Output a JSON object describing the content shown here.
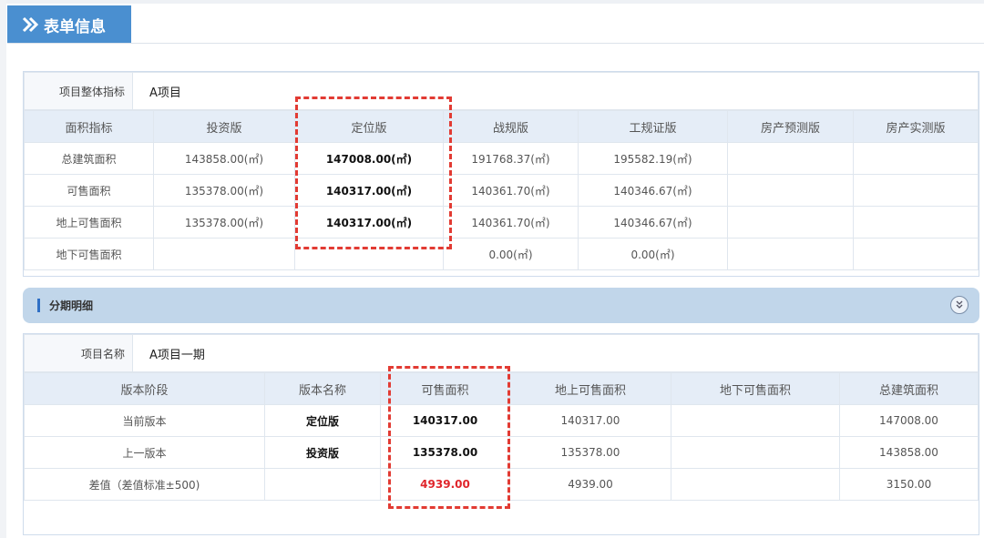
{
  "page": {
    "title": "表单信息"
  },
  "summary": {
    "project_label": "项目整体指标",
    "project_value": "A项目",
    "headers": [
      "面积指标",
      "投资版",
      "定位版",
      "战规版",
      "工规证版",
      "房产预测版",
      "房产实测版"
    ],
    "rows": [
      [
        "总建筑面积",
        "143858.00(㎡)",
        "147008.00(㎡)",
        "191768.37(㎡)",
        "195582.19(㎡)",
        "",
        ""
      ],
      [
        "可售面积",
        "135378.00(㎡)",
        "140317.00(㎡)",
        "140361.70(㎡)",
        "140346.67(㎡)",
        "",
        ""
      ],
      [
        "地上可售面积",
        "135378.00(㎡)",
        "140317.00(㎡)",
        "140361.70(㎡)",
        "140346.67(㎡)",
        "",
        ""
      ],
      [
        "地下可售面积",
        "",
        "",
        "0.00(㎡)",
        "0.00(㎡)",
        "",
        ""
      ]
    ]
  },
  "phase": {
    "section_title": "分期明细",
    "collapse_icon": "double-chevron-down-icon",
    "project_label": "项目名称",
    "project_value": "A项目一期",
    "headers": [
      "版本阶段",
      "版本名称",
      "可售面积",
      "地上可售面积",
      "地下可售面积",
      "总建筑面积"
    ],
    "rows": [
      [
        "当前版本",
        "定位版",
        "140317.00",
        "140317.00",
        "",
        "147008.00"
      ],
      [
        "上一版本",
        "投资版",
        "135378.00",
        "135378.00",
        "",
        "143858.00"
      ],
      [
        "差值（差值标准±500)",
        "",
        "4939.00",
        "4939.00",
        "",
        "3150.00"
      ]
    ]
  },
  "colors": {
    "accent": "#4a8fd0",
    "section_bar": "#c1d6ea",
    "highlight_red": "#e0262c"
  }
}
